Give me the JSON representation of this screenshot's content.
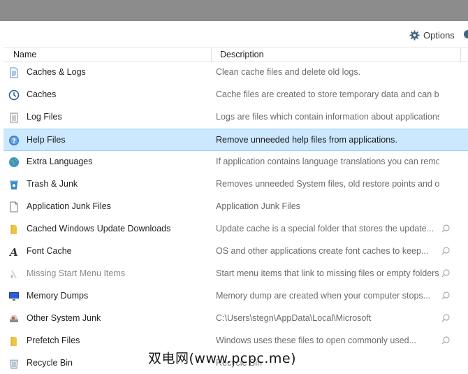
{
  "toolbar": {
    "options_label": "Options"
  },
  "table": {
    "columns": {
      "name": "Name",
      "description": "Description"
    },
    "rows": [
      {
        "name": "Caches & Logs",
        "description": "Clean cache files and delete old logs.",
        "icon": "document-icon"
      },
      {
        "name": "Caches",
        "description": "Cache files are created to store temporary data and can be...",
        "icon": "clock-gear-icon"
      },
      {
        "name": "Log Files",
        "description": "Logs are files which contain information about applications...",
        "icon": "log-notepad-icon"
      },
      {
        "name": "Help Files",
        "description": "Remove unneeded help files from applications.",
        "icon": "help-icon",
        "selected": true
      },
      {
        "name": "Extra Languages",
        "description": "If application contains language translations you can remove...",
        "icon": "globe-icon"
      },
      {
        "name": "Trash & Junk",
        "description": "Removes unneeded System files, old restore points and other...",
        "icon": "trash-icon"
      },
      {
        "name": "Application Junk Files",
        "description": "Application Junk Files",
        "icon": "blank-file-icon"
      },
      {
        "name": "Cached Windows Update Downloads",
        "description": "Update cache is a special folder that stores the update...",
        "icon": "folder-icon",
        "search": true
      },
      {
        "name": "Font Cache",
        "description": "OS and other applications create font caches to keep...",
        "icon": "font-icon",
        "search": true
      },
      {
        "name": "Missing Start Menu Items",
        "description": "Start menu items that link to missing files or empty folders",
        "icon": "shortcut-icon",
        "search": true,
        "dim": true
      },
      {
        "name": "Memory Dumps",
        "description": "Memory dump are created when your computer stops...",
        "icon": "monitor-icon",
        "search": true
      },
      {
        "name": "Other System Junk",
        "description": "C:\\Users\\stegn\\AppData\\Local\\Microsoft",
        "icon": "drive-icon",
        "search": true
      },
      {
        "name": "Prefetch Files",
        "description": "Windows uses these files to open commonly used...",
        "icon": "folder-icon",
        "search": true
      },
      {
        "name": "Recycle Bin",
        "description": "Recycle Bin",
        "icon": "recycle-bin-icon"
      }
    ]
  },
  "watermark": "双电网(www.pcpc.me)"
}
